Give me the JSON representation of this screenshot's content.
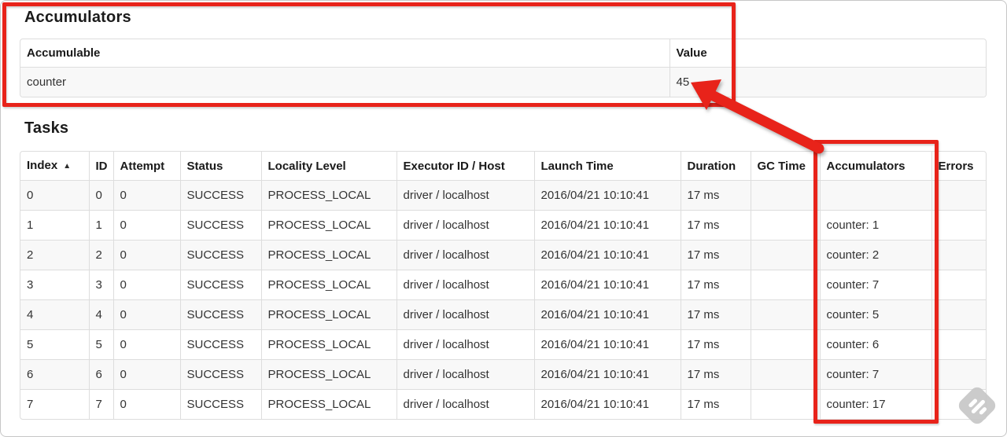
{
  "colors": {
    "annotation_red": "#e8231a",
    "table_border": "#dddddd",
    "row_stripe": "#f8f8f8",
    "text": "#333333",
    "heading_text": "#1b1b1b"
  },
  "accumulators_section": {
    "title": "Accumulators",
    "table": {
      "headers": [
        "Accumulable",
        "Value"
      ],
      "rows": [
        {
          "accumulable": "counter",
          "value": "45"
        }
      ]
    }
  },
  "tasks_section": {
    "title": "Tasks",
    "table": {
      "sort_icon": "▲",
      "col_keys": [
        "index",
        "id",
        "attempt",
        "status",
        "locality-level",
        "executor-id-host",
        "launch-time",
        "duration",
        "gc-time",
        "accumulators",
        "errors"
      ],
      "headers": [
        "Index",
        "ID",
        "Attempt",
        "Status",
        "Locality Level",
        "Executor ID / Host",
        "Launch Time",
        "Duration",
        "GC Time",
        "Accumulators",
        "Errors"
      ],
      "rows": [
        [
          "0",
          "0",
          "0",
          "SUCCESS",
          "PROCESS_LOCAL",
          "driver / localhost",
          "2016/04/21 10:10:41",
          "17 ms",
          "",
          "",
          ""
        ],
        [
          "1",
          "1",
          "0",
          "SUCCESS",
          "PROCESS_LOCAL",
          "driver / localhost",
          "2016/04/21 10:10:41",
          "17 ms",
          "",
          "counter: 1",
          ""
        ],
        [
          "2",
          "2",
          "0",
          "SUCCESS",
          "PROCESS_LOCAL",
          "driver / localhost",
          "2016/04/21 10:10:41",
          "17 ms",
          "",
          "counter: 2",
          ""
        ],
        [
          "3",
          "3",
          "0",
          "SUCCESS",
          "PROCESS_LOCAL",
          "driver / localhost",
          "2016/04/21 10:10:41",
          "17 ms",
          "",
          "counter: 7",
          ""
        ],
        [
          "4",
          "4",
          "0",
          "SUCCESS",
          "PROCESS_LOCAL",
          "driver / localhost",
          "2016/04/21 10:10:41",
          "17 ms",
          "",
          "counter: 5",
          ""
        ],
        [
          "5",
          "5",
          "0",
          "SUCCESS",
          "PROCESS_LOCAL",
          "driver / localhost",
          "2016/04/21 10:10:41",
          "17 ms",
          "",
          "counter: 6",
          ""
        ],
        [
          "6",
          "6",
          "0",
          "SUCCESS",
          "PROCESS_LOCAL",
          "driver / localhost",
          "2016/04/21 10:10:41",
          "17 ms",
          "",
          "counter: 7",
          ""
        ],
        [
          "7",
          "7",
          "0",
          "SUCCESS",
          "PROCESS_LOCAL",
          "driver / localhost",
          "2016/04/21 10:10:41",
          "17 ms",
          "",
          "counter: 17",
          ""
        ]
      ]
    }
  }
}
